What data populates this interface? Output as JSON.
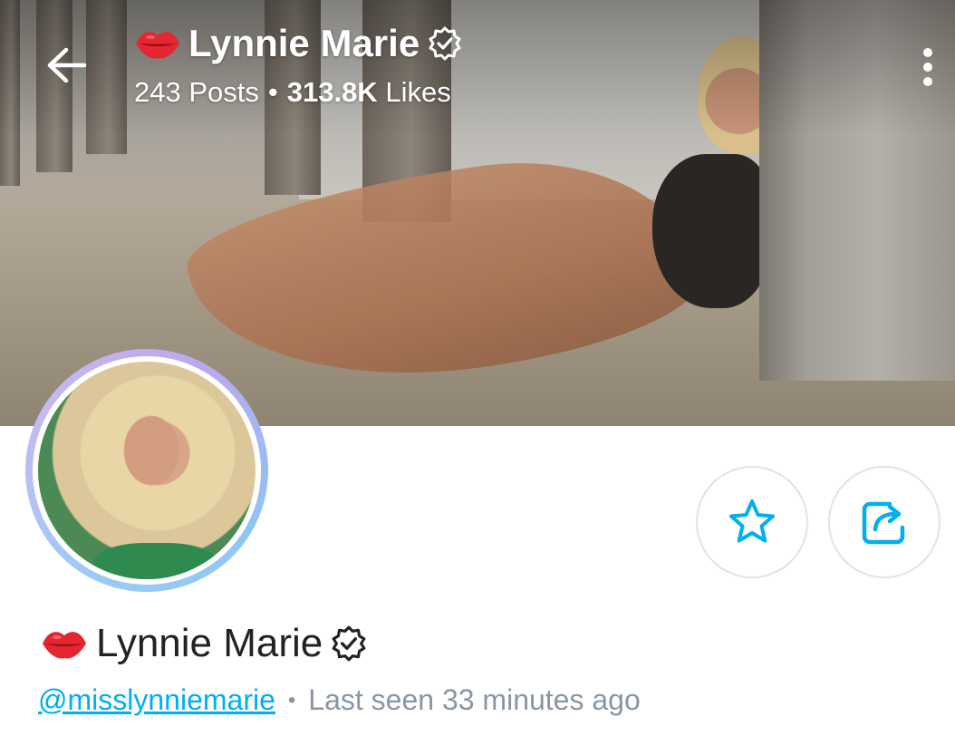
{
  "header": {
    "name": "Lynnie Marie",
    "posts": "243 Posts",
    "separator": "•",
    "likes_count": "313.8K",
    "likes_label": "Likes"
  },
  "profile": {
    "name": "Lynnie Marie",
    "handle": "@misslynniemarie",
    "separator": "•",
    "last_seen": "Last seen 33 minutes ago"
  },
  "icons": {
    "back": "arrow-left-icon",
    "lips": "lips-emoji-icon",
    "verified": "verified-badge-icon",
    "more": "more-vertical-icon",
    "favorite": "star-icon",
    "share": "share-icon"
  },
  "colors": {
    "accent": "#00aff0",
    "muted": "#8a96a3",
    "text": "#222222",
    "lips": "#e3262f"
  }
}
